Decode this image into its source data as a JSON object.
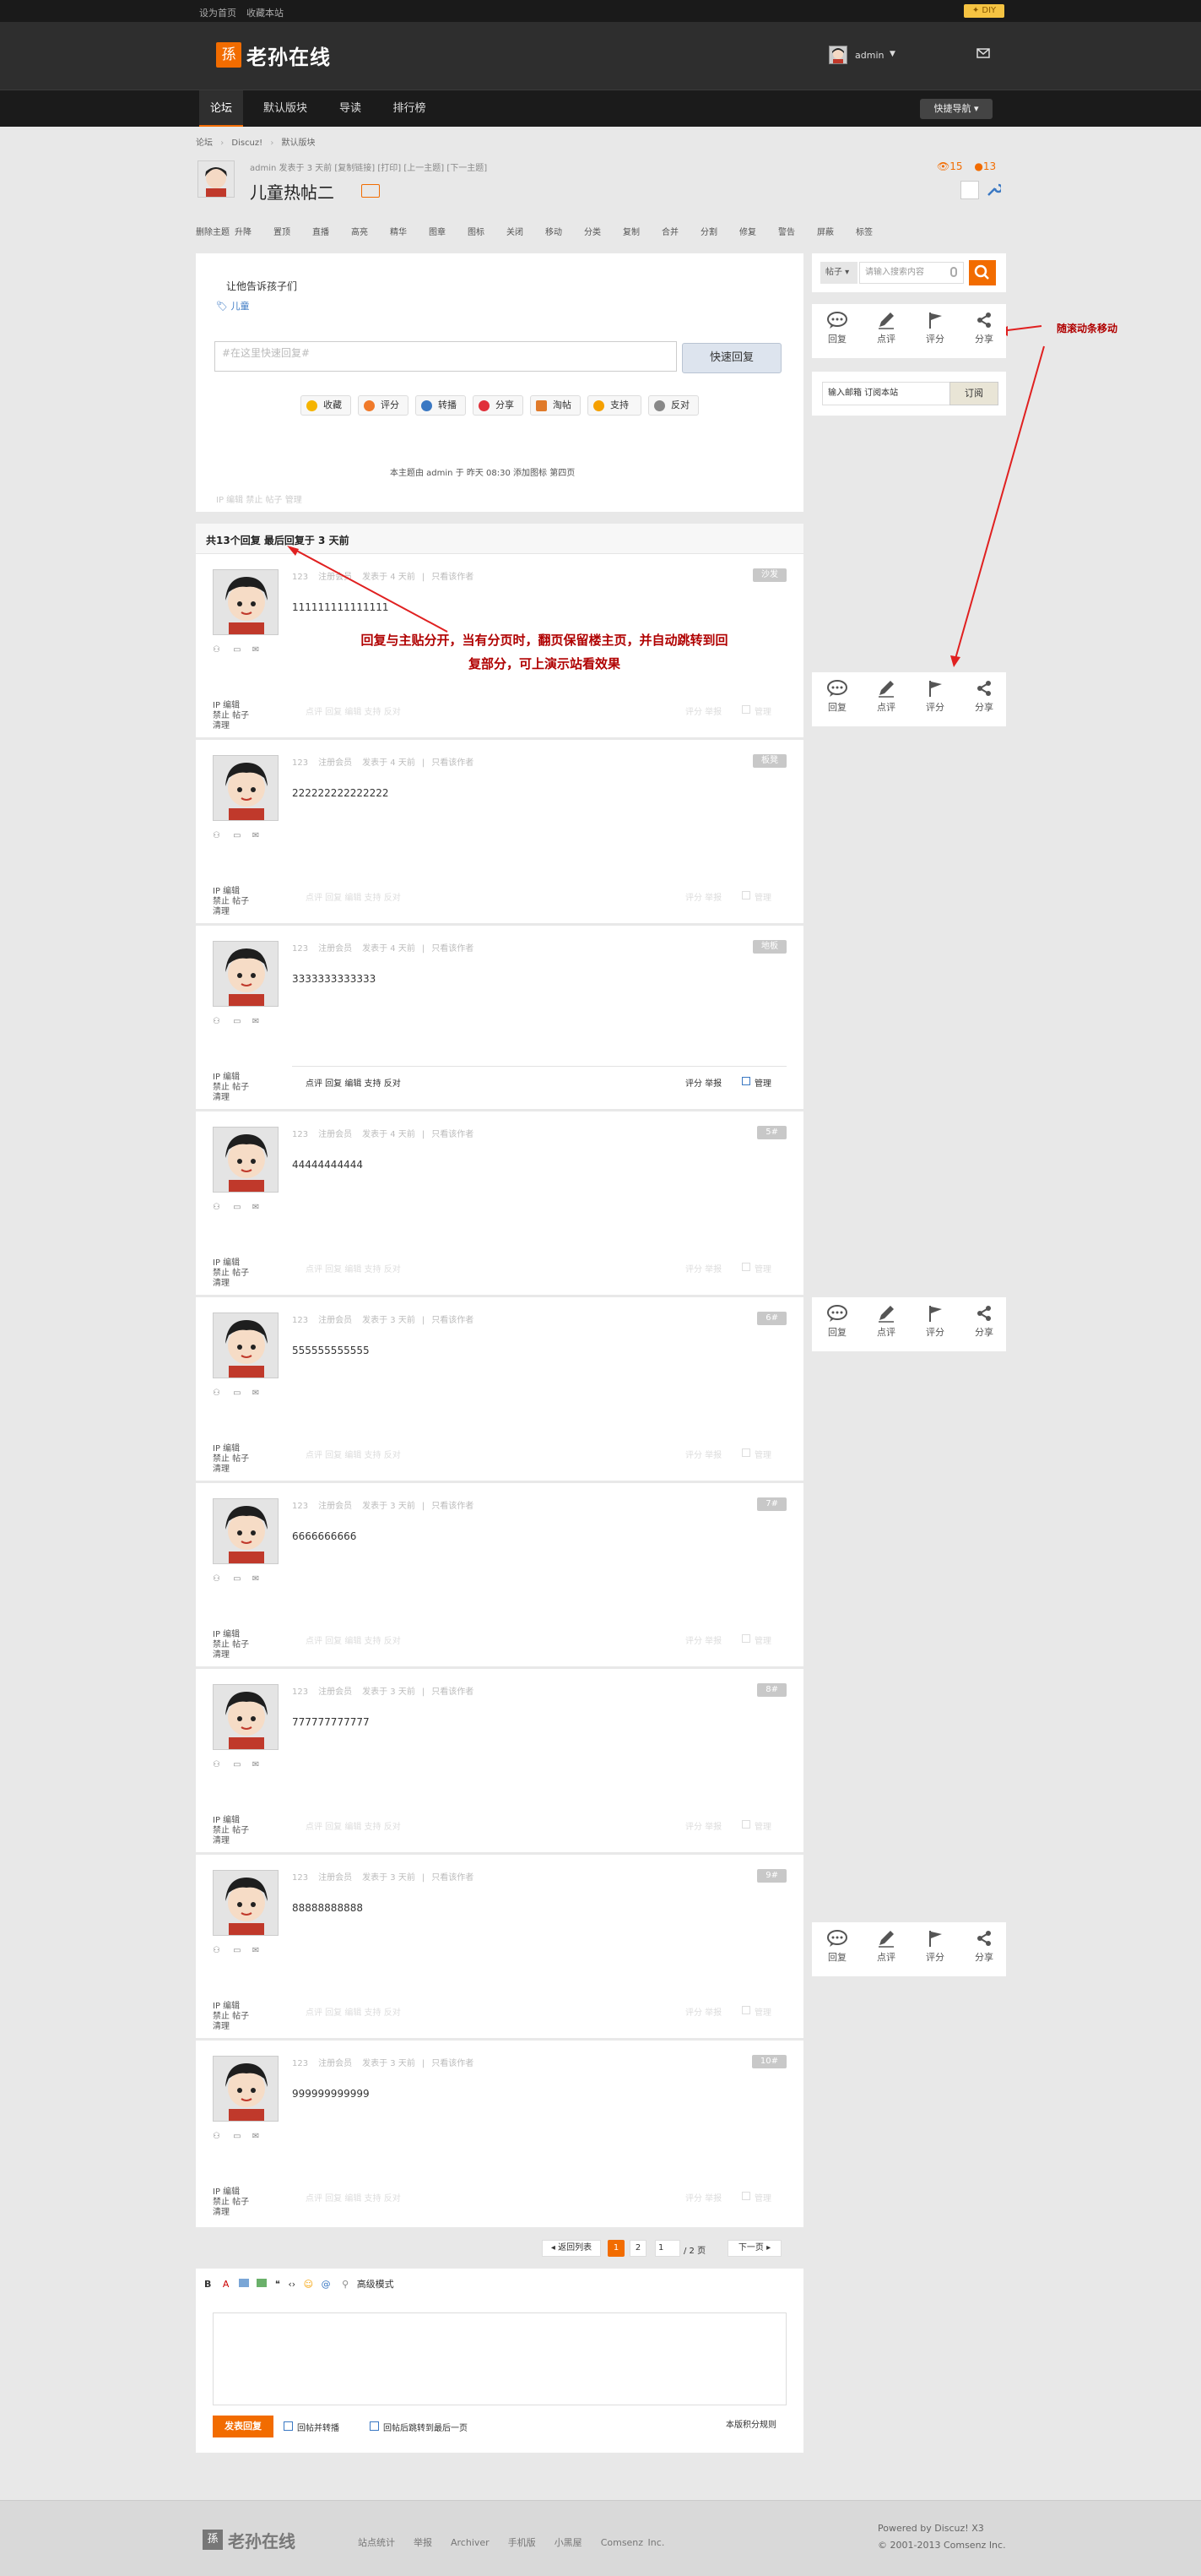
{
  "topbar": {
    "set_home": "设为首页",
    "bookmark": "收藏本站",
    "diy": "DIY"
  },
  "header": {
    "logo_text": "老孙在线",
    "logo_badge": "孫",
    "username": "admin"
  },
  "nav": {
    "items": [
      "论坛",
      "默认版块",
      "导读",
      "排行榜"
    ],
    "quick_nav": "快捷导航"
  },
  "breadcrumb": [
    "论坛",
    "Discuz!",
    "默认版块"
  ],
  "thread": {
    "meta": "admin  发表于 3 天前 [复制链接] [打印] [上一主题] [下一主题]",
    "title": "儿童热帖二",
    "views": "15",
    "replies": "13",
    "admin_tools": [
      "删除主题",
      "升降",
      "置顶",
      "直播",
      "高亮",
      "精华",
      "图章",
      "图标",
      "关闭",
      "移动",
      "分类",
      "复制",
      "合并",
      "分割",
      "修复",
      "警告",
      "屏蔽",
      "标签"
    ]
  },
  "first_post": {
    "body": "让他告诉孩子们",
    "tag": "儿童",
    "quick_reply_placeholder": "#在这里快速回复#",
    "quick_reply_button": "快速回复",
    "buttons": [
      "收藏",
      "评分",
      "转播",
      "分享",
      "淘帖",
      "支持",
      "反对"
    ],
    "status_line": "本主题由 admin 于 昨天 08:30 添加图标 第四页",
    "footer_links": "IP  编辑  禁止  帖子  管理"
  },
  "reply_header": "共13个回复  最后回复于 3 天前",
  "annotations": {
    "reply_split": "回复与主贴分开，当有分页时，翻页保留楼主页，并自动跳转到回复部分，可上演示站看效果",
    "scroll_follow": "随滚动条移动"
  },
  "sidebar": {
    "search_type": "帖子",
    "search_placeholder": "请输入搜索内容",
    "subscribe_placeholder": "输入邮箱 订阅本站",
    "subscribe_button": "订阅",
    "actions": [
      "回复",
      "点评",
      "评分",
      "分享"
    ]
  },
  "posts": [
    {
      "author": "123",
      "group": "注册会员",
      "time": "发表于 4 天前",
      "only": "只看该作者",
      "floor": "沙发",
      "content": "111111111111111"
    },
    {
      "author": "123",
      "group": "注册会员",
      "time": "发表于 4 天前",
      "only": "只看该作者",
      "floor": "板凳",
      "content": "222222222222222"
    },
    {
      "author": "123",
      "group": "注册会员",
      "time": "发表于 4 天前",
      "only": "只看该作者",
      "floor": "地板",
      "content": "3333333333333"
    },
    {
      "author": "123",
      "group": "注册会员",
      "time": "发表于 4 天前",
      "only": "只看该作者",
      "floor": "5#",
      "content": "44444444444"
    },
    {
      "author": "123",
      "group": "注册会员",
      "time": "发表于 3 天前",
      "only": "只看该作者",
      "floor": "6#",
      "content": "555555555555"
    },
    {
      "author": "123",
      "group": "注册会员",
      "time": "发表于 3 天前",
      "only": "只看该作者",
      "floor": "7#",
      "content": "6666666666"
    },
    {
      "author": "123",
      "group": "注册会员",
      "time": "发表于 3 天前",
      "only": "只看该作者",
      "floor": "8#",
      "content": "777777777777"
    },
    {
      "author": "123",
      "group": "注册会员",
      "time": "发表于 3 天前",
      "only": "只看该作者",
      "floor": "9#",
      "content": "88888888888"
    },
    {
      "author": "123",
      "group": "注册会员",
      "time": "发表于 3 天前",
      "only": "只看该作者",
      "floor": "10#",
      "content": "999999999999"
    }
  ],
  "post_left_links": {
    "l1": "IP  编辑",
    "l2": "禁止  帖子",
    "l3": "清理"
  },
  "post_actions": {
    "left": "点评  回复  编辑  支持  反对",
    "right": "评分  举报",
    "manage": "管理"
  },
  "pagination": {
    "back": "返回列表",
    "pages": [
      "1",
      "2"
    ],
    "current_input": "1",
    "total": "/ 2 页",
    "next": "下一页"
  },
  "editor": {
    "advanced": "高级模式",
    "submit": "发表回复",
    "opt1": "回帖并转播",
    "opt2": "回帖后跳转到最后一页",
    "credit": "本版积分规则"
  },
  "footer": {
    "logo_text": "老孙在线",
    "links": [
      "站点统计",
      "举报",
      "Archiver",
      "手机版",
      "小黑屋",
      "Comsenz Inc."
    ],
    "powered": "Powered by Discuz! X3",
    "copyright": "© 2001-2013 Comsenz Inc."
  }
}
